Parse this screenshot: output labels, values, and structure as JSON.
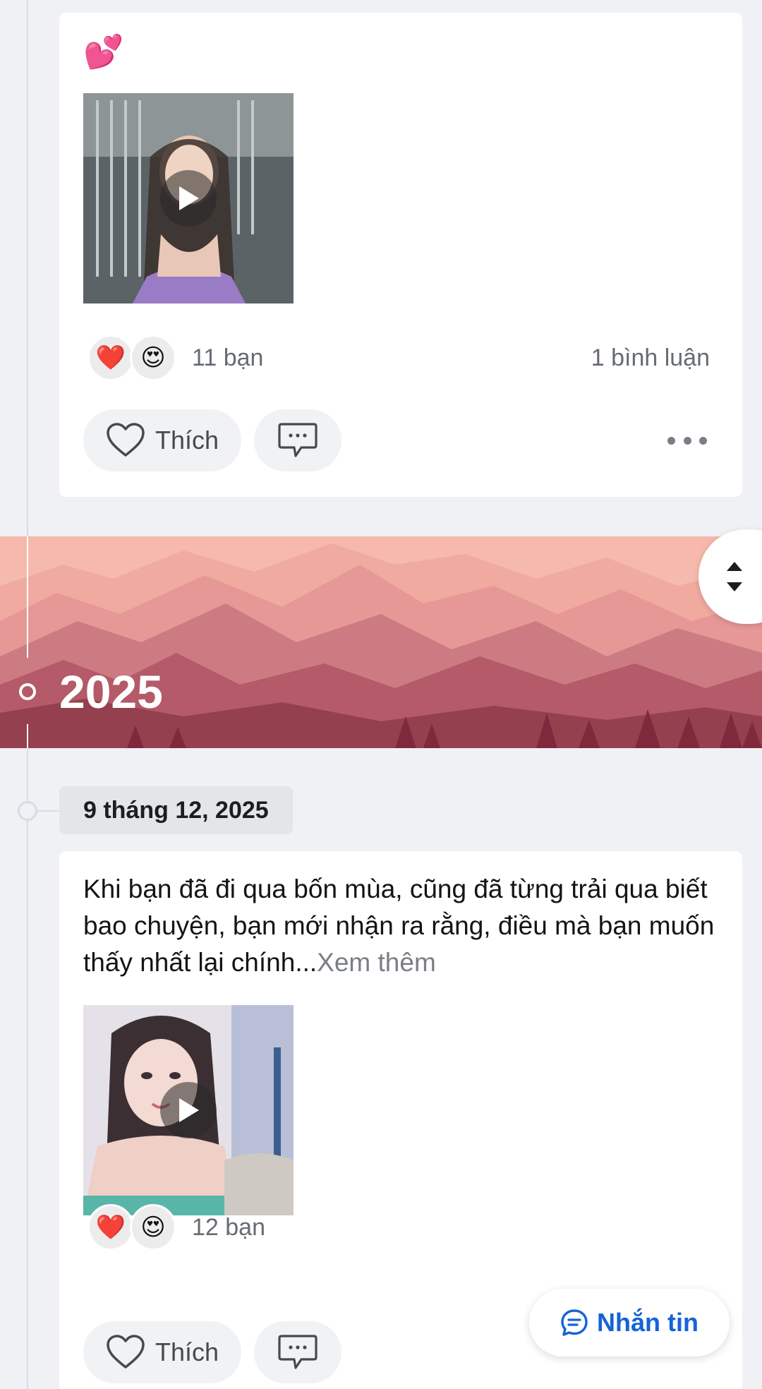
{
  "posts": [
    {
      "text_emoji": "💕",
      "reactions": [
        "❤️",
        "😍"
      ],
      "reaction_count": "11 bạn",
      "comment_count": "1 bình luận",
      "like_label": "Thích"
    },
    {
      "date": "9 tháng 12, 2025",
      "text": "Khi bạn đã đi qua bốn mùa, cũng đã từng trải qua biết bao chuyện, bạn mới nhận ra rằng, điều mà bạn muốn thấy nhất lại chính...",
      "see_more": "Xem thêm",
      "reactions": [
        "❤️",
        "😍"
      ],
      "reaction_count": "12 bạn",
      "like_label": "Thích"
    }
  ],
  "year_banner": {
    "year": "2025"
  },
  "message_button": {
    "label": "Nhắn tin"
  },
  "icons": {
    "play": "play-icon",
    "heart": "heart-outline-icon",
    "comment": "comment-bubble-icon",
    "more": "more-horizontal-icon",
    "scroll": "scroll-up-down-icon",
    "message": "message-bubble-icon"
  },
  "colors": {
    "accent": "#1563d6",
    "banner_light": "#f6b8aa",
    "banner_dark": "#7e2a3c"
  }
}
